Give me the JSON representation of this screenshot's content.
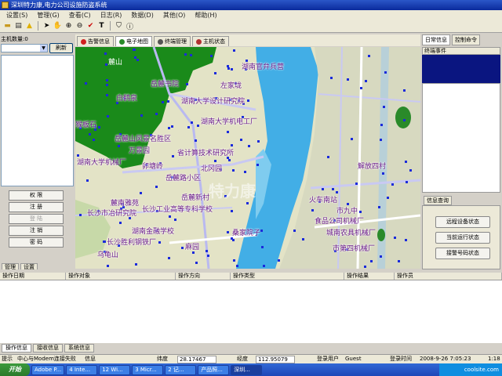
{
  "window": {
    "title": "深圳特力康,电力公司设施防盗系统"
  },
  "menu": [
    "设置(S)",
    "管理(G)",
    "查看(C)",
    "日志(R)",
    "数据(D)",
    "其他(O)",
    "帮助(H)"
  ],
  "toolbar_icons": [
    "folder-icon",
    "save-icon",
    "warning-icon",
    "pointer-icon",
    "hand-pan-icon",
    "zoom-in-icon",
    "zoom-out-icon",
    "measure-check-icon",
    "text-icon",
    "shield-icon",
    "info-icon"
  ],
  "left_panel": {
    "host_label": "主机数量:0",
    "host_select_value": "",
    "refresh_label": "刷新",
    "buttons": [
      {
        "label": "权 限",
        "disabled": false
      },
      {
        "label": "注 册",
        "disabled": false
      },
      {
        "label": "登 陆",
        "disabled": true
      },
      {
        "label": "注 销",
        "disabled": false
      },
      {
        "label": "密 码",
        "disabled": false
      }
    ],
    "tabs": [
      "管理",
      "设置"
    ]
  },
  "map_tabs": [
    {
      "label": "告警信息",
      "icon": "alert-icon",
      "color": "#d02020",
      "active": false
    },
    {
      "label": "电子地图",
      "icon": "globe-icon",
      "color": "#2a8a2a",
      "active": true
    },
    {
      "label": "终端管理",
      "icon": "terminal-icon",
      "color": "#555555",
      "active": false
    },
    {
      "label": "主机状态",
      "icon": "tools-icon",
      "color": "#b03030",
      "active": false
    }
  ],
  "map": {
    "labels": [
      {
        "text": "麓山",
        "white": true
      },
      {
        "text": "岳麓书院",
        "white": false
      },
      {
        "text": "白鹤泉",
        "white": false
      },
      {
        "text": "湖南官弁兵营",
        "white": false
      },
      {
        "text": "左家垅",
        "white": false
      },
      {
        "text": "湖南大学设计研究院",
        "white": false
      },
      {
        "text": "湖南大学机电工厂",
        "white": false
      },
      {
        "text": "岳麓山风景名胜区",
        "white": false
      },
      {
        "text": "万景园",
        "white": false
      },
      {
        "text": "省计算技术研究所",
        "white": false
      },
      {
        "text": "北冈园",
        "white": false
      },
      {
        "text": "岳麓路小区",
        "white": false
      },
      {
        "text": "岳麓新村",
        "white": false
      },
      {
        "text": "麓南雅苑",
        "white": false
      },
      {
        "text": "长沙市冶研究院",
        "white": false
      },
      {
        "text": "长沙工业高等专科学校",
        "white": false
      },
      {
        "text": "湖南金融学校",
        "white": false
      },
      {
        "text": "长沙胜利钢铁厂",
        "white": false
      },
      {
        "text": "乌龟山",
        "white": false
      },
      {
        "text": "麻园",
        "white": false
      },
      {
        "text": "桑家院子",
        "white": false
      },
      {
        "text": "火车南站",
        "white": false
      },
      {
        "text": "市九中",
        "white": false
      },
      {
        "text": "食品公司机械厂",
        "white": false
      },
      {
        "text": "城南农具机械厂",
        "white": false
      },
      {
        "text": "市第四机械厂",
        "white": false
      },
      {
        "text": "解放四村",
        "white": false
      },
      {
        "text": "猴板石",
        "white": false
      },
      {
        "text": "湖南大学机械厂",
        "white": false
      },
      {
        "text": "卯塘岭",
        "white": false
      }
    ],
    "watermark": "特力康"
  },
  "right_panel": {
    "tabs": [
      {
        "label": "日常信息",
        "active": true
      },
      {
        "label": "控制命令",
        "active": false
      }
    ],
    "event_header": "终端事件",
    "info_tab": "信息查询",
    "info_buttons": [
      "远程设备状态",
      "当前运行状态",
      "接警号码状态"
    ]
  },
  "op_log": {
    "columns": [
      "操作日期",
      "操作对象",
      "操作方向",
      "操作类型",
      "操作结果",
      "操作员"
    ]
  },
  "bottom_tabs": [
    {
      "label": "操作信息",
      "active": true
    },
    {
      "label": "接收信息",
      "active": false
    },
    {
      "label": "系统信息",
      "active": false
    }
  ],
  "status": {
    "prompt_label": "提示",
    "prompt_value": "中心与Modem连接失败",
    "info_label": "信息",
    "lat_label": "纬度",
    "lat_value": "28.17467",
    "lon_label": "经度",
    "lon_value": "112.95079",
    "user_label": "登录用户",
    "user_value": "Guest",
    "time_label": "登录时间",
    "time_value": "2008-9-26 7:05:23",
    "scale_value": "1:18"
  },
  "taskbar": {
    "start": "开始",
    "tasks": [
      {
        "label": "Adobe P...",
        "active": false
      },
      {
        "label": "4 Inte...",
        "active": false
      },
      {
        "label": "12 Wi...",
        "active": false
      },
      {
        "label": "3 Micr...",
        "active": false
      },
      {
        "label": "2 记...",
        "active": false
      },
      {
        "label": "产品照...",
        "active": false
      },
      {
        "label": "深圳...",
        "active": true
      }
    ],
    "tray": "coolsite.com"
  }
}
